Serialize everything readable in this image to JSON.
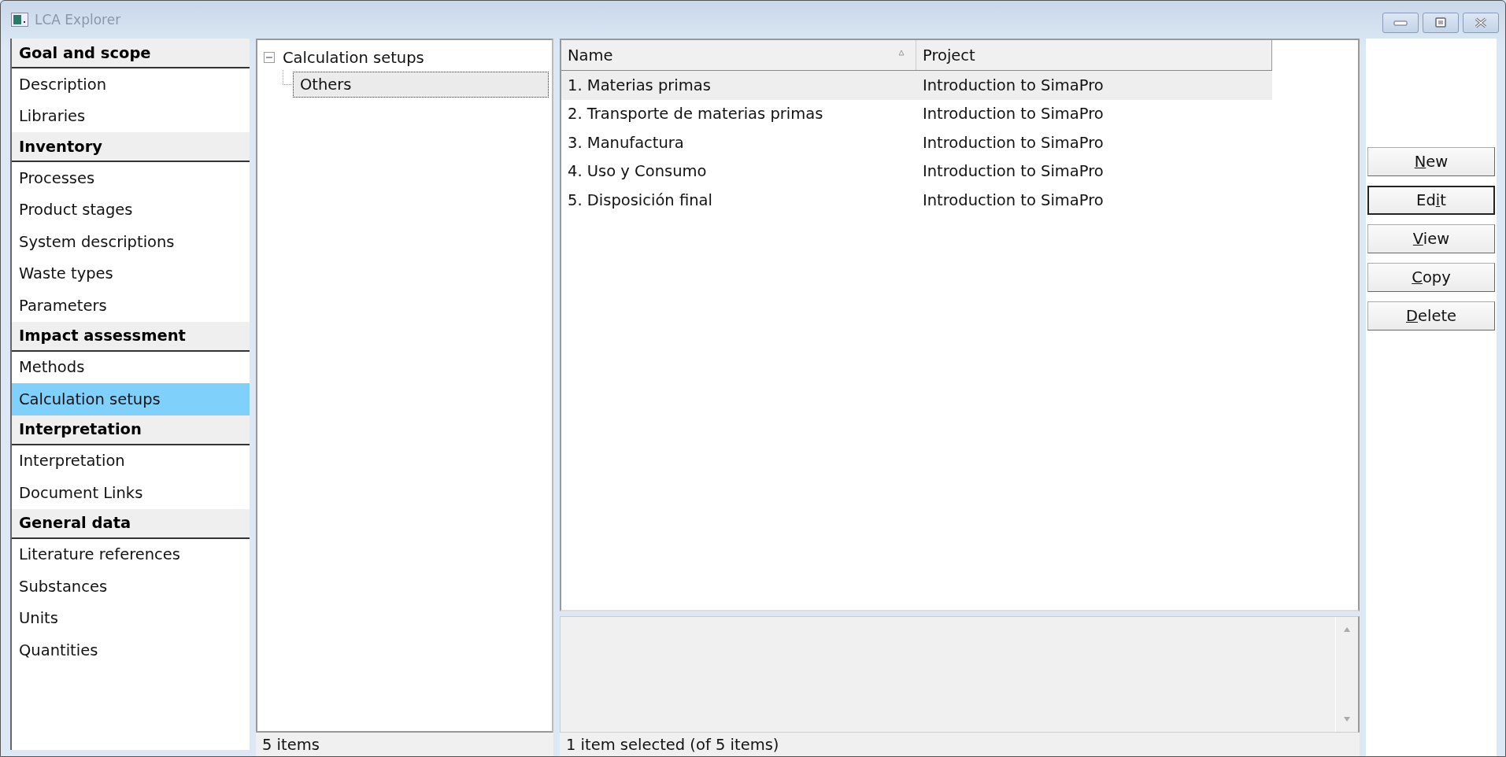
{
  "window": {
    "title": "LCA Explorer"
  },
  "sidebar": {
    "sections": [
      {
        "title": "Goal and scope",
        "items": [
          {
            "label": "Description",
            "selected": false
          },
          {
            "label": "Libraries",
            "selected": false
          }
        ]
      },
      {
        "title": "Inventory",
        "items": [
          {
            "label": "Processes",
            "selected": false
          },
          {
            "label": "Product stages",
            "selected": false
          },
          {
            "label": "System descriptions",
            "selected": false
          },
          {
            "label": "Waste types",
            "selected": false
          },
          {
            "label": "Parameters",
            "selected": false
          }
        ]
      },
      {
        "title": "Impact assessment",
        "items": [
          {
            "label": "Methods",
            "selected": false
          },
          {
            "label": "Calculation setups",
            "selected": true
          }
        ]
      },
      {
        "title": "Interpretation",
        "items": [
          {
            "label": "Interpretation",
            "selected": false
          },
          {
            "label": "Document Links",
            "selected": false
          }
        ]
      },
      {
        "title": "General data",
        "items": [
          {
            "label": "Literature references",
            "selected": false
          },
          {
            "label": "Substances",
            "selected": false
          },
          {
            "label": "Units",
            "selected": false
          },
          {
            "label": "Quantities",
            "selected": false
          }
        ]
      }
    ]
  },
  "tree": {
    "root": {
      "label": "Calculation setups",
      "expanded": true,
      "children": [
        {
          "label": "Others",
          "selected": true
        }
      ]
    }
  },
  "table": {
    "columns": [
      {
        "label": "Name",
        "sorted": true
      },
      {
        "label": "Project",
        "sorted": false
      }
    ],
    "rows": [
      {
        "name": "1. Materias primas",
        "project": "Introduction to SimaPro",
        "selected": true
      },
      {
        "name": "2. Transporte de materias primas",
        "project": "Introduction to SimaPro",
        "selected": false
      },
      {
        "name": "3. Manufactura",
        "project": "Introduction to SimaPro",
        "selected": false
      },
      {
        "name": "4. Uso y Consumo",
        "project": "Introduction to SimaPro",
        "selected": false
      },
      {
        "name": "5. Disposición final",
        "project": "Introduction to SimaPro",
        "selected": false
      }
    ]
  },
  "buttons": [
    {
      "key": "N",
      "after": "ew",
      "default": false
    },
    {
      "before": "Ed",
      "key": "i",
      "after": "t",
      "default": true
    },
    {
      "key": "V",
      "after": "iew",
      "default": false
    },
    {
      "key": "C",
      "after": "opy",
      "default": false
    },
    {
      "key": "D",
      "after": "elete",
      "default": false
    }
  ],
  "status_bar": {
    "left": "5 items",
    "right": "1 item selected (of 5 items)"
  }
}
